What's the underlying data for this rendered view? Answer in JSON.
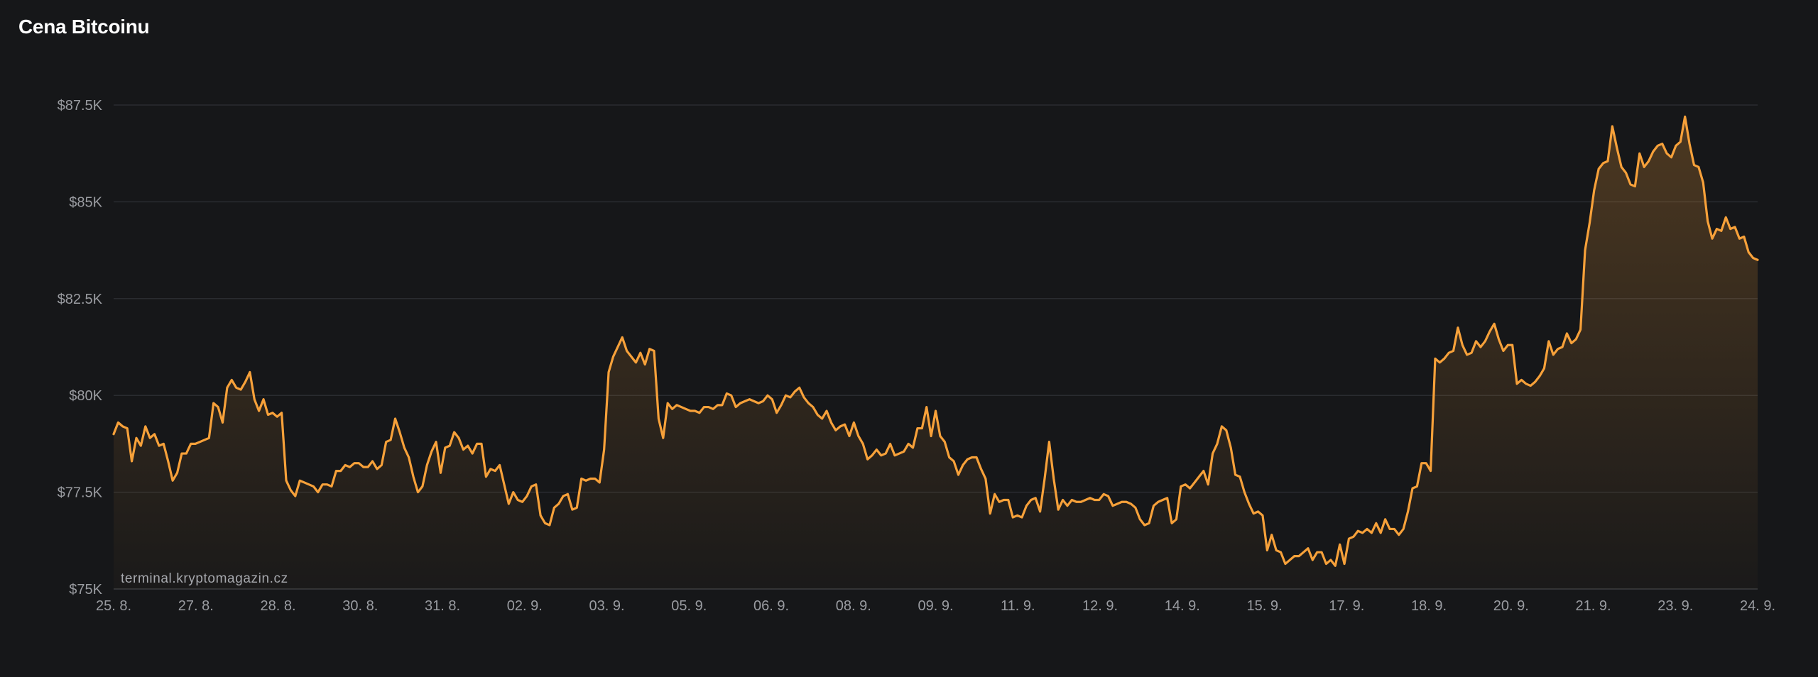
{
  "chart_data": {
    "type": "area",
    "title": "Cena Bitcoinu",
    "xlabel": "",
    "ylabel": "",
    "watermark": "terminal.kryptomagazin.cz",
    "line_color": "#f7a13a",
    "grid": true,
    "ylim": [
      75000,
      87500
    ],
    "y_ticks": [
      {
        "value": 75000,
        "label": "$75K"
      },
      {
        "value": 77500,
        "label": "$77.5K"
      },
      {
        "value": 80000,
        "label": "$80K"
      },
      {
        "value": 82500,
        "label": "$82.5K"
      },
      {
        "value": 85000,
        "label": "$85K"
      },
      {
        "value": 87500,
        "label": "$87.5K"
      }
    ],
    "x_ticks": [
      "25. 8.",
      "27. 8.",
      "28. 8.",
      "30. 8.",
      "31. 8.",
      "02. 9.",
      "03. 9.",
      "05. 9.",
      "06. 9.",
      "08. 9.",
      "09. 9.",
      "11. 9.",
      "12. 9.",
      "14. 9.",
      "15. 9.",
      "17. 9.",
      "18. 9.",
      "20. 9.",
      "21. 9.",
      "23. 9.",
      "24. 9."
    ],
    "series": [
      {
        "values": [
          79000,
          79300,
          79200,
          79150,
          78300,
          78900,
          78700,
          79200,
          78900,
          79000,
          78700,
          78750,
          78300,
          77800,
          78000,
          78500,
          78500,
          78750,
          78750,
          78800,
          78850,
          78900,
          79800,
          79700,
          79300,
          80200,
          80400,
          80200,
          80150,
          80350,
          80600,
          79900,
          79600,
          79900,
          79500,
          79550,
          79450,
          79550,
          77800,
          77550,
          77400,
          77800,
          77750,
          77700,
          77650,
          77500,
          77700,
          77700,
          77650,
          78050,
          78050,
          78200,
          78150,
          78250,
          78250,
          78150,
          78150,
          78300,
          78100,
          78200,
          78800,
          78850,
          79400,
          79050,
          78650,
          78400,
          77900,
          77500,
          77650,
          78200,
          78550,
          78800,
          78000,
          78650,
          78700,
          79050,
          78900,
          78600,
          78700,
          78500,
          78750,
          78750,
          77900,
          78100,
          78050,
          78200,
          77700,
          77200,
          77500,
          77300,
          77250,
          77400,
          77650,
          77700,
          76900,
          76700,
          76650,
          77100,
          77200,
          77400,
          77450,
          77050,
          77100,
          77850,
          77800,
          77850,
          77850,
          77750,
          78600,
          80600,
          81000,
          81250,
          81500,
          81150,
          81000,
          80850,
          81100,
          80800,
          81200,
          81150,
          79400,
          78900,
          79800,
          79650,
          79750,
          79700,
          79650,
          79600,
          79600,
          79550,
          79700,
          79700,
          79650,
          79750,
          79750,
          80050,
          80000,
          79700,
          79800,
          79850,
          79900,
          79850,
          79800,
          79850,
          80000,
          79900,
          79550,
          79750,
          80000,
          79950,
          80100,
          80200,
          79950,
          79800,
          79700,
          79500,
          79400,
          79600,
          79300,
          79100,
          79200,
          79250,
          78950,
          79300,
          78950,
          78750,
          78350,
          78450,
          78600,
          78450,
          78500,
          78750,
          78450,
          78500,
          78550,
          78750,
          78650,
          79150,
          79150,
          79700,
          78950,
          79600,
          78950,
          78800,
          78400,
          78300,
          77950,
          78200,
          78350,
          78400,
          78400,
          78100,
          77850,
          76950,
          77450,
          77250,
          77300,
          77300,
          76850,
          76900,
          76850,
          77150,
          77300,
          77350,
          77000,
          77850,
          78800,
          77850,
          77050,
          77300,
          77150,
          77300,
          77250,
          77250,
          77300,
          77350,
          77300,
          77300,
          77450,
          77400,
          77150,
          77200,
          77250,
          77250,
          77200,
          77100,
          76800,
          76650,
          76700,
          77150,
          77250,
          77300,
          77350,
          76700,
          76800,
          77650,
          77700,
          77600,
          77750,
          77900,
          78050,
          77700,
          78500,
          78750,
          79200,
          79100,
          78650,
          77950,
          77900,
          77500,
          77200,
          76950,
          77000,
          76900,
          76000,
          76400,
          76000,
          75950,
          75650,
          75750,
          75850,
          75850,
          75950,
          76050,
          75750,
          75950,
          75950,
          75650,
          75750,
          75600,
          76150,
          75650,
          76300,
          76350,
          76500,
          76450,
          76550,
          76450,
          76700,
          76450,
          76800,
          76550,
          76550,
          76400,
          76550,
          77000,
          77600,
          77650,
          78250,
          78250,
          78050,
          80950,
          80850,
          80950,
          81100,
          81150,
          81750,
          81300,
          81050,
          81100,
          81400,
          81250,
          81400,
          81650,
          81850,
          81450,
          81150,
          81300,
          81300,
          80300,
          80400,
          80300,
          80250,
          80350,
          80500,
          80700,
          81400,
          81050,
          81200,
          81250,
          81600,
          81350,
          81450,
          81700,
          83750,
          84450,
          85300,
          85850,
          86000,
          86050,
          86950,
          86400,
          85900,
          85750,
          85450,
          85400,
          86250,
          85900,
          86050,
          86300,
          86450,
          86500,
          86250,
          86150,
          86450,
          86550,
          87200,
          86500,
          85950,
          85900,
          85500,
          84500,
          84050,
          84300,
          84250,
          84600,
          84300,
          84350,
          84050,
          84100,
          83700,
          83550,
          83500
        ]
      }
    ]
  }
}
